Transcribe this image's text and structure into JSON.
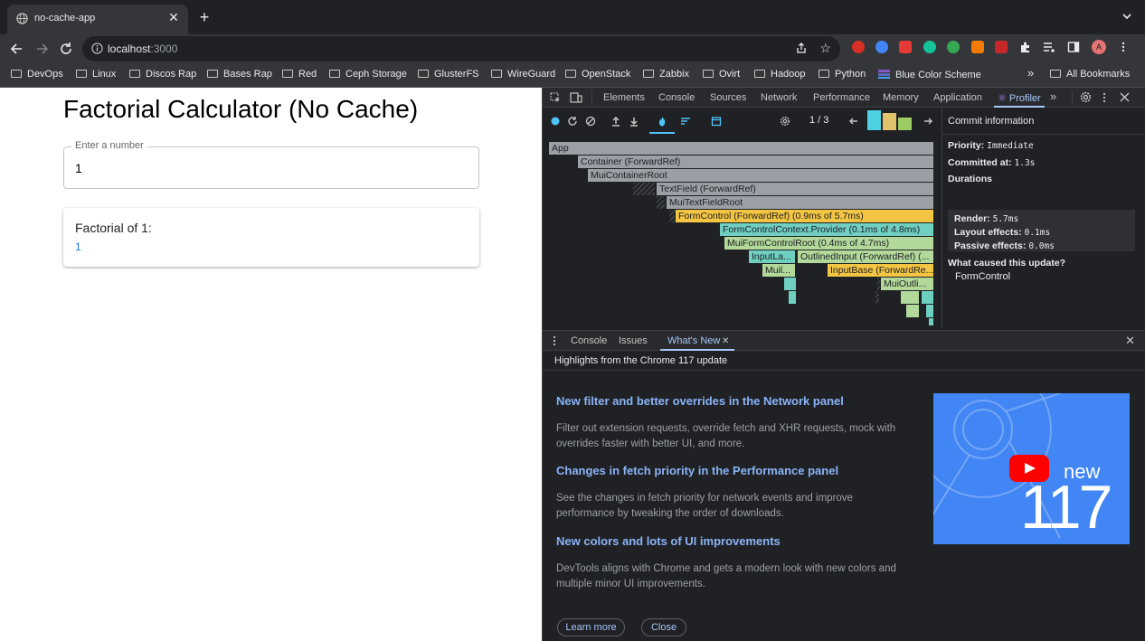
{
  "browser": {
    "tab_title": "no-cache-app",
    "tab_close": "✕",
    "new_tab": "+",
    "url_host": "localhost",
    "url_port": ":3000",
    "bookmarks": [
      "DevOps",
      "Linux",
      "Discos Rap",
      "Bases Rap",
      "Red",
      "Ceph Storage",
      "GlusterFS",
      "WireGuard",
      "OpenStack",
      "Zabbix",
      "Ovirt",
      "Hadoop",
      "Python",
      "Blue Color Scheme"
    ],
    "bookmarks_overflow": "»",
    "all_bookmarks": "All Bookmarks",
    "profile_initial": "A"
  },
  "page": {
    "title": "Factorial Calculator (No Cache)",
    "input_label": "Enter a number",
    "input_value": "1",
    "result_label": "Factorial of 1:",
    "result_value": "1"
  },
  "devtools": {
    "tabs": [
      "Elements",
      "Console",
      "Sources",
      "Network",
      "Performance",
      "Memory",
      "Application",
      "Profiler"
    ],
    "active_tab": "Profiler",
    "more_tabs": "»",
    "commit_nav": "1 / 3",
    "flame": {
      "app": "App",
      "container": "Container (ForwardRef)",
      "mui_container_root": "MuiContainerRoot",
      "text_field": "TextField (ForwardRef)",
      "mui_text_field_root": "MuiTextFieldRoot",
      "form_control": "FormControl (ForwardRef) (0.9ms of 5.7ms)",
      "form_control_provider": "FormControlContext.Provider (0.1ms of 4.8ms)",
      "mui_form_control_root": "MuiFormControlRoot (0.4ms of 4.7ms)",
      "input_label": "InputLa...",
      "outlined_input": "OutlinedInput (ForwardRef) (...",
      "mui_small": "Muil...",
      "input_base": "InputBase (ForwardRe...",
      "mui_outlined": "MuiOutli..."
    },
    "commit_info": {
      "title": "Commit information",
      "priority_label": "Priority:",
      "priority_value": "Immediate",
      "committed_label": "Committed at:",
      "committed_value": "1.3s",
      "durations_label": "Durations",
      "render_label": "Render:",
      "render_value": "5.7ms",
      "layout_label": "Layout effects:",
      "layout_value": "0.1ms",
      "passive_label": "Passive effects:",
      "passive_value": "0.0ms",
      "cause_label": "What caused this update?",
      "cause_value": "FormControl"
    },
    "drawer": {
      "tabs": [
        "Console",
        "Issues",
        "What's New"
      ],
      "active_tab": "What's New",
      "tab_close": "✕",
      "close": "✕",
      "subhead": "Highlights from the Chrome 117 update",
      "items": [
        {
          "title": "New filter and better overrides in the Network panel",
          "body": "Filter out extension requests, override fetch and XHR requests, mock with overrides faster with better UI, and more."
        },
        {
          "title": "Changes in fetch priority in the Performance panel",
          "body": "See the changes in fetch priority for network events and improve performance by tweaking the order of downloads."
        },
        {
          "title": "New colors and lots of UI improvements",
          "body": "DevTools aligns with Chrome and gets a modern look with new colors and multiple minor UI improvements."
        }
      ],
      "image_new": "new",
      "image_version": "117",
      "learn_more": "Learn more",
      "close_btn": "Close"
    }
  },
  "colors": {
    "accent": "#a8c7fa",
    "link": "#8ab4f8",
    "flame_gold": "#f4c542",
    "flame_teal": "#6fd0c2",
    "page_link": "#1976d2"
  }
}
